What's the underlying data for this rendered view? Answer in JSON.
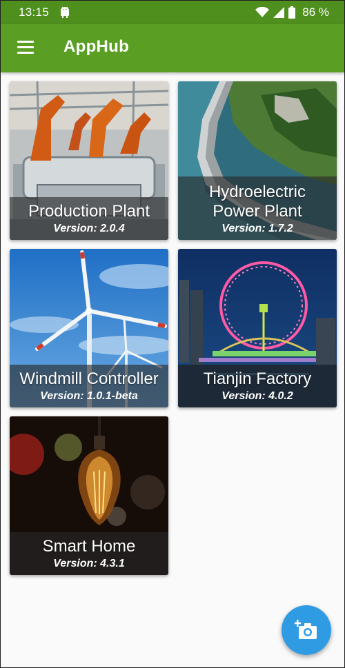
{
  "status_bar": {
    "time": "13:15",
    "battery": "86 %"
  },
  "app_bar": {
    "title": "AppHub"
  },
  "cards": [
    {
      "title": "Production Plant",
      "version": "Version: 2.0.4"
    },
    {
      "title": "Hydroelectric\nPower Plant",
      "version": "Version: 1.7.2"
    },
    {
      "title": "Windmill Controller",
      "version": "Version: 1.0.1-beta"
    },
    {
      "title": "Tianjin Factory",
      "version": "Version: 4.0.2"
    },
    {
      "title": "Smart Home",
      "version": "Version: 4.3.1"
    }
  ],
  "colors": {
    "status_bar": "#4e8f1d",
    "app_bar": "#5b9e24",
    "fab": "#2f9be3"
  },
  "icons": {
    "menu": "menu-icon",
    "fab": "add-camera-icon"
  }
}
